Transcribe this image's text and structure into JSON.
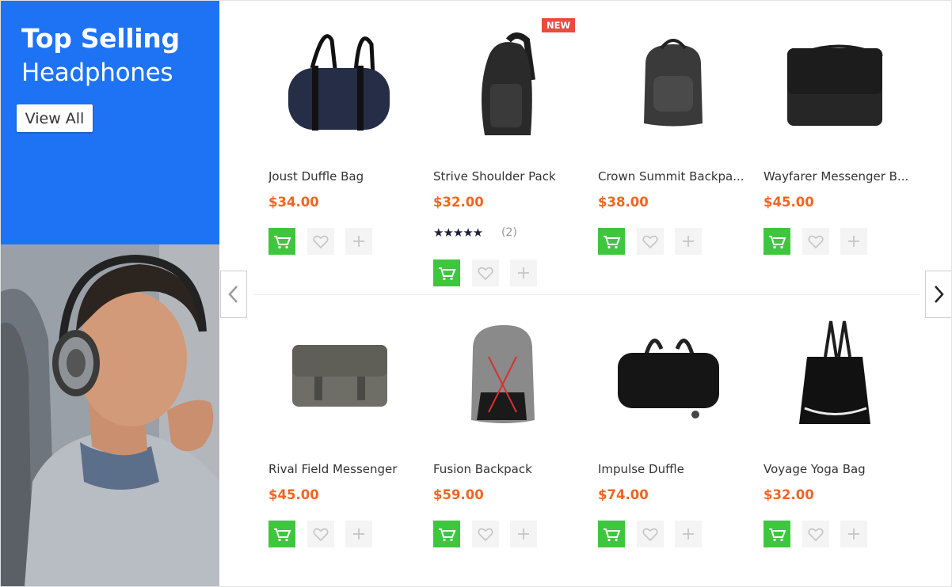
{
  "banner": {
    "title": "Top Selling",
    "subtitle": "Headphones",
    "cta_label": "View All"
  },
  "colors": {
    "banner_bg": "#1e73f5",
    "price": "#f26522",
    "cart_button": "#3ec73e",
    "badge": "#e74c3c"
  },
  "products": [
    {
      "name": "Joust Duffle Bag",
      "price": "$34.00",
      "image_icon": "duffle-bag-icon"
    },
    {
      "name": "Strive Shoulder Pack",
      "price": "$32.00",
      "badge": "NEW",
      "rating": 5,
      "stars": "★★★★★",
      "reviews": "(2)",
      "image_icon": "shoulder-pack-icon"
    },
    {
      "name": "Crown Summit Backpa...",
      "price": "$38.00",
      "image_icon": "backpack-icon"
    },
    {
      "name": "Wayfarer Messenger B...",
      "price": "$45.00",
      "image_icon": "messenger-bag-icon"
    },
    {
      "name": "Rival Field Messenger",
      "price": "$45.00",
      "image_icon": "messenger-bag-icon"
    },
    {
      "name": "Fusion Backpack",
      "price": "$59.00",
      "image_icon": "backpack-icon"
    },
    {
      "name": "Impulse Duffle",
      "price": "$74.00",
      "image_icon": "rolling-duffle-icon"
    },
    {
      "name": "Voyage Yoga Bag",
      "price": "$32.00",
      "image_icon": "tote-bag-icon"
    }
  ],
  "icons": {
    "cart": "cart-icon",
    "wishlist": "heart-icon",
    "compare": "plus-icon",
    "prev": "chevron-left-icon",
    "next": "chevron-right-icon"
  }
}
